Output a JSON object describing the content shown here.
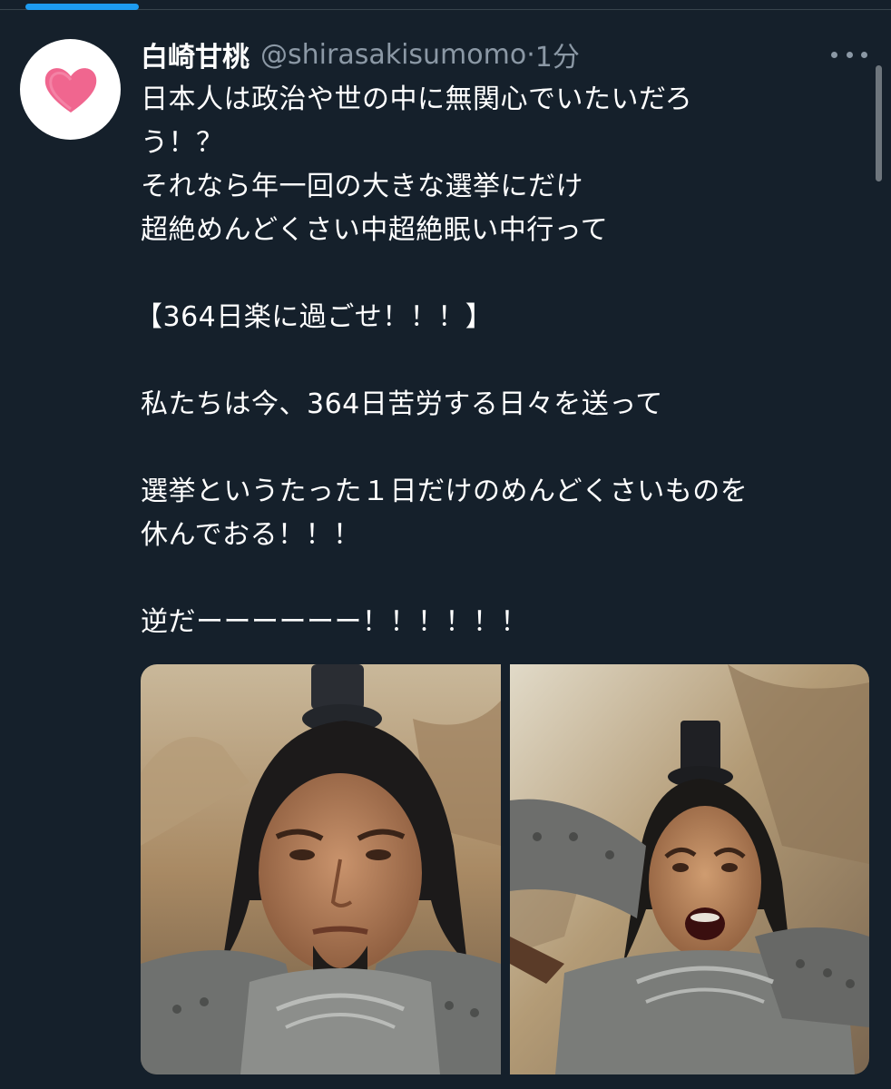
{
  "tweet": {
    "display_name": "白崎甘桃",
    "handle": "@shirasakisumomo",
    "separator": "·",
    "time": "1分",
    "avatar_icon": "heart-icon",
    "more_icon": "more-options-icon",
    "body_lines": [
      "日本人は政治や世の中に無関心でいたいだろ",
      "う！？",
      "それなら年一回の大きな選挙にだけ",
      "超絶めんどくさい中超絶眠い中行って",
      "",
      "【364日楽に過ごせ！！！】",
      "",
      "私たちは今、364日苦労する日々を送って",
      "",
      "選挙というたった１日だけのめんどくさいものを",
      "休んでおる！！！",
      "",
      "逆だーーーーーー！！！！！！"
    ],
    "media": [
      {
        "kind": "photo",
        "description_icon": "photo-warrior-stern"
      },
      {
        "kind": "photo",
        "description_icon": "photo-warrior-shouting"
      }
    ]
  },
  "colors": {
    "background": "#15202b",
    "text_primary": "#ffffff",
    "text_secondary": "#8b98a5",
    "accent": "#1d9bf0",
    "heart": "#f0668f"
  }
}
